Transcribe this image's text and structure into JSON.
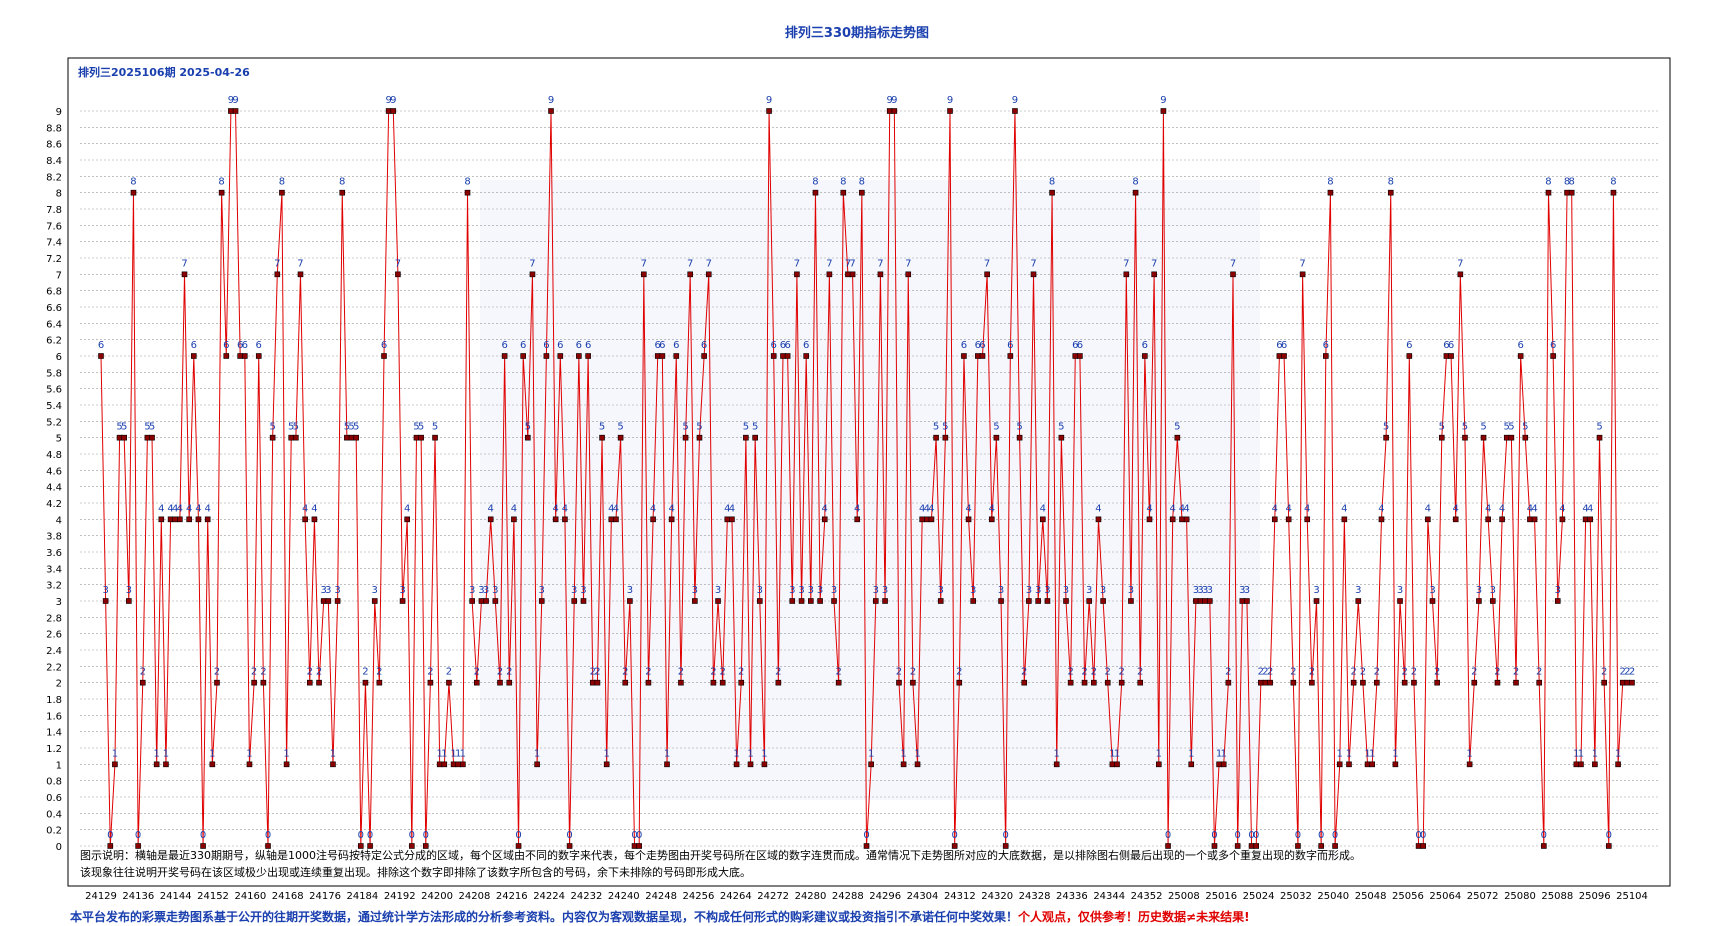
{
  "chart_data": {
    "type": "line",
    "title": "排列三330期指标走势图",
    "subtitle": "排列三2025106期  2025-04-26",
    "ylim": [
      0,
      9
    ],
    "y_ticks": [
      "0",
      "0.2",
      "0.4",
      "0.6",
      "0.8",
      "1",
      "1.2",
      "1.4",
      "1.6",
      "1.8",
      "2",
      "2.2",
      "2.4",
      "2.6",
      "2.8",
      "3",
      "3.2",
      "3.4",
      "3.6",
      "3.8",
      "4",
      "4.2",
      "4.4",
      "4.6",
      "4.8",
      "5",
      "5.2",
      "5.4",
      "5.6",
      "5.8",
      "6",
      "6.2",
      "6.4",
      "6.6",
      "6.8",
      "7",
      "7.2",
      "7.4",
      "7.6",
      "7.8",
      "8",
      "8.2",
      "8.4",
      "8.6",
      "8.8",
      "9"
    ],
    "x_ticks": [
      "24129",
      "24136",
      "24144",
      "24152",
      "24160",
      "24168",
      "24176",
      "24184",
      "24192",
      "24200",
      "24208",
      "24216",
      "24224",
      "24232",
      "24240",
      "24248",
      "24256",
      "24264",
      "24272",
      "24280",
      "24288",
      "24296",
      "24304",
      "24312",
      "24320",
      "24328",
      "24336",
      "24344",
      "24352",
      "25008",
      "25016",
      "25024",
      "25032",
      "25040",
      "25048",
      "25056",
      "25064",
      "25072",
      "25080",
      "25088",
      "25096",
      "25104"
    ],
    "grid": true,
    "series": [
      {
        "color": "#e00000",
        "values": [
          6,
          3,
          0,
          1,
          5,
          5,
          3,
          8,
          0,
          2,
          5,
          5,
          1,
          4,
          1,
          4,
          4,
          4,
          7,
          4,
          6,
          4,
          0,
          4,
          1,
          2,
          8,
          6,
          9,
          9,
          6,
          6,
          1,
          2,
          6,
          2,
          0,
          5,
          7,
          8,
          1,
          5,
          5,
          7,
          4,
          2,
          4,
          2,
          3,
          3,
          1,
          3,
          8,
          5,
          5,
          5,
          0,
          2,
          0,
          3,
          2,
          6,
          9,
          9,
          7,
          3,
          4,
          0,
          5,
          5,
          0,
          2,
          5,
          1,
          1,
          2,
          1,
          1,
          1,
          8,
          3,
          2,
          3,
          3,
          4,
          3,
          2,
          6,
          2,
          4,
          0,
          6,
          5,
          7,
          1,
          3,
          6,
          9,
          4,
          6,
          4,
          0,
          3,
          6,
          3,
          6,
          2,
          2,
          5,
          1,
          4,
          4,
          5,
          2,
          3,
          0,
          0,
          7,
          2,
          4,
          6,
          6,
          1,
          4,
          6,
          2,
          5,
          7,
          3,
          5,
          6,
          7,
          2,
          3,
          2,
          4,
          4,
          1,
          2,
          5,
          1,
          5,
          3,
          1,
          9,
          6,
          2,
          6,
          6,
          3,
          7,
          3,
          6,
          3,
          8,
          3,
          4,
          7,
          3,
          2,
          8,
          7,
          7,
          4,
          8,
          0,
          1,
          3,
          7,
          3,
          9,
          9,
          2,
          1,
          7,
          2,
          1,
          4,
          4,
          4,
          5,
          3,
          5,
          9,
          0,
          2,
          6,
          4,
          3,
          6,
          6,
          7,
          4,
          5,
          3,
          0,
          6,
          9,
          5,
          2,
          3,
          7,
          3,
          4,
          3,
          8,
          1,
          5,
          3,
          2,
          6,
          6,
          2,
          3,
          2,
          4,
          3,
          2,
          1,
          1,
          2,
          7,
          3,
          8,
          2,
          6,
          4,
          7,
          1,
          9,
          0,
          4,
          5,
          4,
          4,
          1,
          3,
          3,
          3,
          3,
          0,
          1,
          1,
          2,
          7,
          0,
          3,
          3,
          0,
          0,
          2,
          2,
          2,
          4,
          6,
          6,
          4,
          2,
          0,
          7,
          4,
          2,
          3,
          0,
          6,
          8,
          0,
          1,
          4,
          1,
          2,
          3,
          2,
          1,
          1,
          2,
          4,
          5,
          8,
          1,
          3,
          2,
          6,
          2,
          0,
          0,
          4,
          3,
          2,
          5,
          6,
          6,
          4,
          7,
          5,
          1,
          2,
          3,
          5,
          4,
          3,
          2,
          4,
          5,
          5,
          2,
          6,
          5,
          4,
          4,
          2,
          0,
          8,
          6,
          3,
          4,
          8,
          8,
          1,
          1,
          4,
          4,
          1,
          5,
          2,
          0,
          8,
          1,
          2,
          2,
          2
        ]
      }
    ]
  },
  "legend_note_line1": "图示说明：横轴是最近330期期号，纵轴是1000注号码按特定公式分成的区域，每个区域由不同的数字来代表，每个走势图由开奖号码所在区域的数字连贯而成。通常情况下走势图所对应的大底数据，是以排除图右侧最后出现的一个或多个重复出现的数字而形成。",
  "legend_note_line2": "该现象往往说明开奖号码在该区域极少出现或连续重复出现。排除这个数字即排除了该数字所包含的号码，余下未排除的号码即形成大底。",
  "footer_blue": "本平台发布的彩票走势图系基于公开的往期开奖数据，通过统计学方法形成的分析参考资料。内容仅为客观数据呈现，不构成任何形式的购彩建议或投资指引不承诺任何中奖效果！",
  "footer_red": "个人观点，仅供参考！历史数据≠未来结果!"
}
